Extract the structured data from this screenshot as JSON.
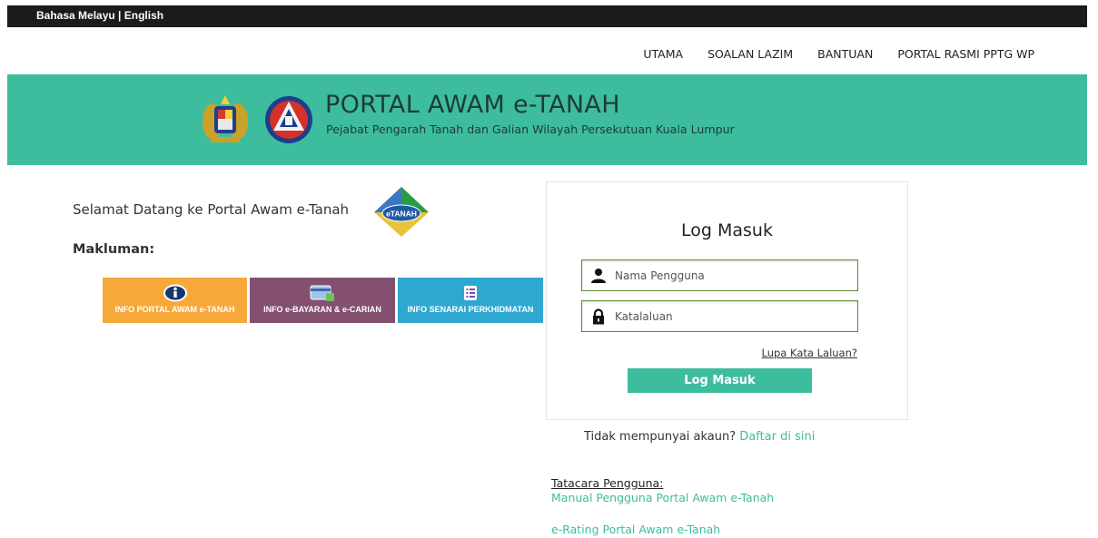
{
  "lang_bar": {
    "malay": "Bahasa Melayu",
    "separator": " | ",
    "english": "English"
  },
  "nav": {
    "items": [
      {
        "label": "UTAMA"
      },
      {
        "label": "SOALAN LAZIM"
      },
      {
        "label": "BANTUAN"
      },
      {
        "label": "PORTAL RASMI PPTG WP"
      }
    ]
  },
  "banner": {
    "title": "PORTAL AWAM e-TANAH",
    "subtitle": "Pejabat Pengarah Tanah dan Galian Wilayah Persekutuan Kuala Lumpur",
    "logo_left_icon": "coat-of-arms-icon",
    "logo_right_icon": "pptg-seal-icon"
  },
  "welcome": {
    "text": "Selamat Datang ke Portal Awam e-Tanah",
    "logo_text": "eTANAH",
    "makluman": "Makluman:"
  },
  "tiles": [
    {
      "label": "INFO PORTAL AWAM e-TANAH",
      "icon": "info-icon",
      "color": "#f6a83b"
    },
    {
      "label": "INFO e-BAYARAN & e-CARIAN",
      "icon": "payment-card-icon",
      "color": "#84506f"
    },
    {
      "label": "INFO SENARAI PERKHIDMATAN",
      "icon": "list-icon",
      "color": "#2fa8d1"
    }
  ],
  "login": {
    "heading": "Log Masuk",
    "username_placeholder": "Nama Pengguna",
    "password_placeholder": "Katalaluan",
    "forgot": "Lupa Kata Laluan?",
    "button": "Log Masuk"
  },
  "register": {
    "prompt": "Tidak mempunyai akaun?",
    "link": "Daftar di sini"
  },
  "guide": {
    "label": "Tatacara Pengguna:",
    "manual_link": "Manual Pengguna Portal Awam e-Tanah",
    "rating_link": "e-Rating Portal Awam e-Tanah"
  },
  "colors": {
    "brand": "#3dbd9e",
    "dark_bar": "#1b1b1b"
  }
}
